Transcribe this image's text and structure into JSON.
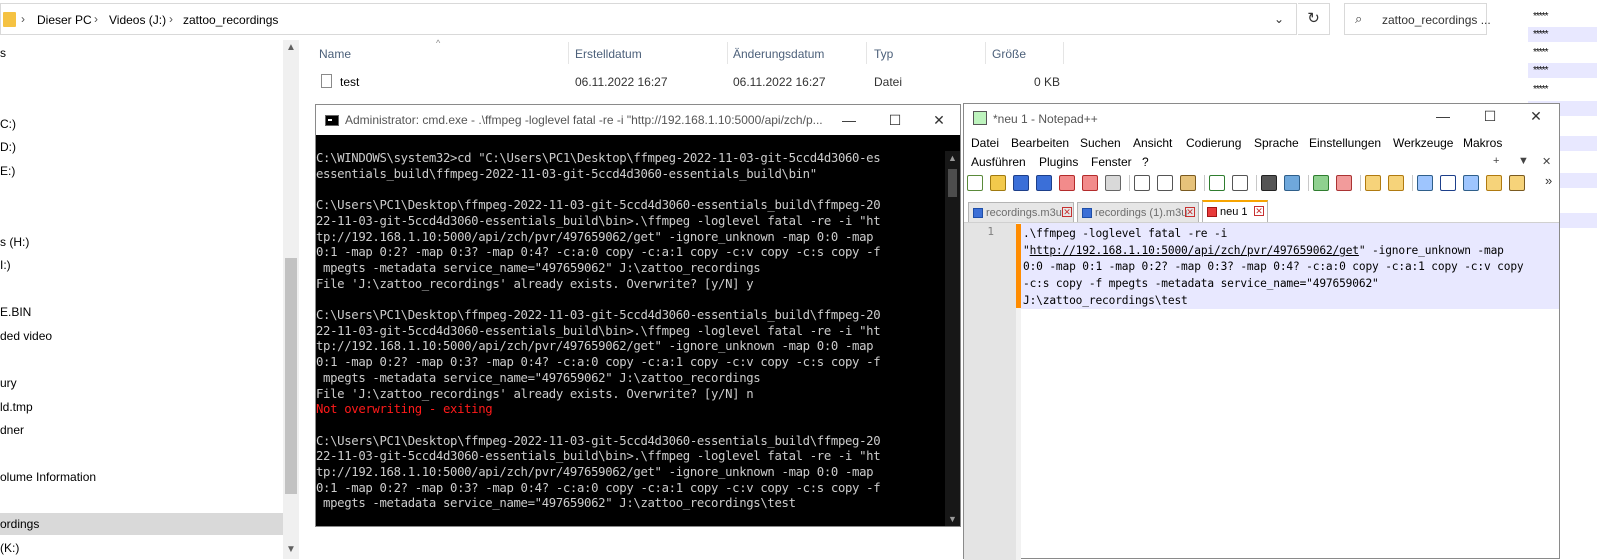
{
  "explorer": {
    "breadcrumbs": [
      "Dieser PC",
      "Videos (J:)",
      "zattoo_recordings"
    ],
    "search_placeholder": "zattoo_recordings ...",
    "nav_items": [
      {
        "label": "s"
      },
      {
        "label": "C:)"
      },
      {
        "label": "D:)"
      },
      {
        "label": "E:)"
      },
      {
        "label": "s (H:)"
      },
      {
        "label": "I:)"
      },
      {
        "label": "E.BIN"
      },
      {
        "label": "ded video"
      },
      {
        "label": "ury"
      },
      {
        "label": "ld.tmp"
      },
      {
        "label": "dner"
      },
      {
        "label": "olume Information"
      },
      {
        "label": "ordings"
      },
      {
        "label": "(K:)"
      }
    ],
    "columns": [
      "Name",
      "Erstelldatum",
      "Änderungsdatum",
      "Typ",
      "Größe"
    ],
    "files": [
      {
        "name": "test",
        "created": "06.11.2022 16:27",
        "modified": "06.11.2022 16:27",
        "type": "Datei",
        "size": "0 KB"
      }
    ]
  },
  "right_strip": {
    "stars": [
      "*****",
      "*****",
      "*****",
      "*****",
      "*****",
      "*****",
      "*****",
      "*****",
      "*****",
      "*****",
      "*****",
      "*****"
    ]
  },
  "cmd": {
    "title": "Administrator: cmd.exe - .\\ffmpeg  -loglevel fatal -re -i \"http://192.168.1.10:5000/api/zch/p...",
    "lines": [
      {
        "t": "C:\\WINDOWS\\system32>cd \"C:\\Users\\PC1\\Desktop\\ffmpeg-2022-11-03-git-5ccd4d3060-es"
      },
      {
        "t": "essentials_build\\ffmpeg-2022-11-03-git-5ccd4d3060-essentials_build\\bin\""
      },
      {
        "t": ""
      },
      {
        "t": "C:\\Users\\PC1\\Desktop\\ffmpeg-2022-11-03-git-5ccd4d3060-essentials_build\\ffmpeg-20"
      },
      {
        "t": "22-11-03-git-5ccd4d3060-essentials_build\\bin>.\\ffmpeg -loglevel fatal -re -i \"ht"
      },
      {
        "t": "tp://192.168.1.10:5000/api/zch/pvr/497659062/get\" -ignore_unknown -map 0:0 -map"
      },
      {
        "t": "0:1 -map 0:2? -map 0:3? -map 0:4? -c:a:0 copy -c:a:1 copy -c:v copy -c:s copy -f"
      },
      {
        "t": " mpegts -metadata service_name=\"497659062\" J:\\zattoo_recordings"
      },
      {
        "t": "File 'J:\\zattoo_recordings' already exists. Overwrite? [y/N] y"
      },
      {
        "t": ""
      },
      {
        "t": "C:\\Users\\PC1\\Desktop\\ffmpeg-2022-11-03-git-5ccd4d3060-essentials_build\\ffmpeg-20"
      },
      {
        "t": "22-11-03-git-5ccd4d3060-essentials_build\\bin>.\\ffmpeg -loglevel fatal -re -i \"ht"
      },
      {
        "t": "tp://192.168.1.10:5000/api/zch/pvr/497659062/get\" -ignore_unknown -map 0:0 -map"
      },
      {
        "t": "0:1 -map 0:2? -map 0:3? -map 0:4? -c:a:0 copy -c:a:1 copy -c:v copy -c:s copy -f"
      },
      {
        "t": " mpegts -metadata service_name=\"497659062\" J:\\zattoo_recordings"
      },
      {
        "t": "File 'J:\\zattoo_recordings' already exists. Overwrite? [y/N] n"
      },
      {
        "t": "Not overwriting - exiting",
        "red": true
      },
      {
        "t": ""
      },
      {
        "t": "C:\\Users\\PC1\\Desktop\\ffmpeg-2022-11-03-git-5ccd4d3060-essentials_build\\ffmpeg-20"
      },
      {
        "t": "22-11-03-git-5ccd4d3060-essentials_build\\bin>.\\ffmpeg -loglevel fatal -re -i \"ht"
      },
      {
        "t": "tp://192.168.1.10:5000/api/zch/pvr/497659062/get\" -ignore_unknown -map 0:0 -map"
      },
      {
        "t": "0:1 -map 0:2? -map 0:3? -map 0:4? -c:a:0 copy -c:a:1 copy -c:v copy -c:s copy -f"
      },
      {
        "t": " mpegts -metadata service_name=\"497659062\" J:\\zattoo_recordings\\test"
      }
    ]
  },
  "notepad": {
    "title": "*neu 1 - Notepad++",
    "menu_row1": [
      "Datei",
      "Bearbeiten",
      "Suchen",
      "Ansicht",
      "Codierung",
      "Sprache",
      "Einstellungen",
      "Werkzeuge",
      "Makros"
    ],
    "menu_row2": [
      "Ausführen",
      "Plugins",
      "Fenster",
      "?"
    ],
    "tabs": [
      {
        "label": "recordings.m3u"
      },
      {
        "label": "recordings (1).m3u"
      },
      {
        "label": "neu 1",
        "active": true
      }
    ],
    "line_number": "1",
    "code_parts": {
      "pre": ".\\ffmpeg -loglevel fatal -re -i\n\"",
      "url": "http://192.168.1.10:5000/api/zch/pvr/497659062/get",
      "post": "\" -ignore_unknown -map\n0:0 -map 0:1 -map 0:2? -map 0:3? -map 0:4? -c:a:0 copy -c:a:1 copy -c:v copy\n-c:s copy -f mpegts -metadata service_name=\"497659062\"\nJ:\\zattoo_recordings\\test"
    }
  }
}
